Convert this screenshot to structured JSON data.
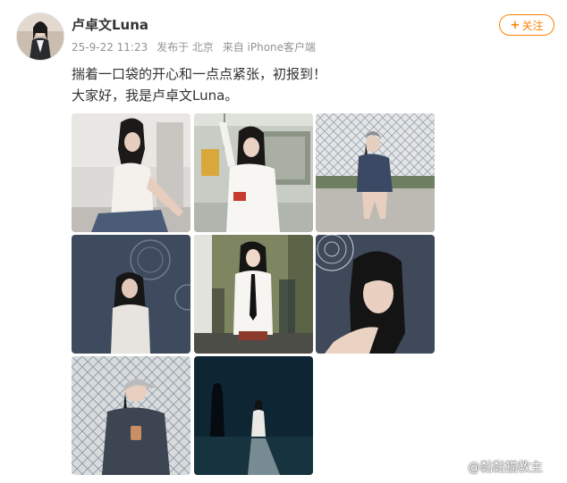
{
  "post": {
    "username": "卢卓文Luna",
    "timestamp": "25-9-22 11:23",
    "location": "发布于 北京",
    "source": "来自 iPhone客户端",
    "follow_label": "关注",
    "text_lines": [
      "揣着一口袋的开心和一点点紧张，初报到！",
      "大家好，我是卢卓文Luna。"
    ]
  },
  "photos": [
    {
      "id": 1
    },
    {
      "id": 2
    },
    {
      "id": 3
    },
    {
      "id": 4
    },
    {
      "id": 5
    },
    {
      "id": 6
    },
    {
      "id": 7
    },
    {
      "id": 8
    }
  ],
  "watermark": {
    "text": "@黏黏猫教主",
    "icon": "weibo-icon"
  }
}
